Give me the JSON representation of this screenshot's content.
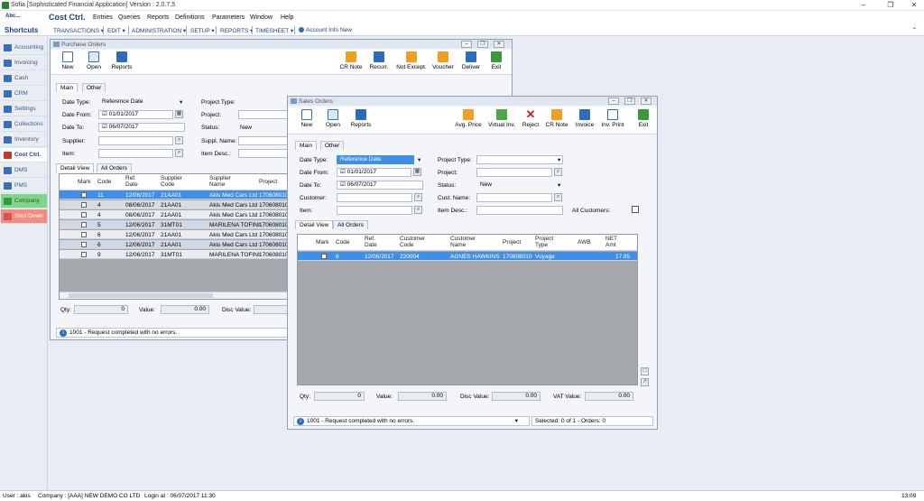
{
  "window_title": "Sofia [Sophisticated Financial Application] Version : 2.0.7.5",
  "menubar": {
    "logo": "Abc...",
    "module": "Cost Ctrl.",
    "items": [
      "Entries",
      "Queries",
      "Reports",
      "Definitions",
      "Parameters",
      "Window",
      "Help"
    ]
  },
  "shortcuts": {
    "title": "Shortcuts",
    "items": [
      "TRANSACTIONS ▾",
      "EDIT ▾",
      "ADMINISTRATION ▾",
      "SETUP ▾",
      "REPORTS ▾",
      "TIMESHEET ▾",
      "Account Info New"
    ]
  },
  "sidebar": [
    {
      "label": "Accounting",
      "color": "#3b6fb5"
    },
    {
      "label": "Invoicing",
      "color": "#3b6fb5"
    },
    {
      "label": "Cash",
      "color": "#3b6fb5"
    },
    {
      "label": "CRM",
      "color": "#3b6fb5"
    },
    {
      "label": "Settings",
      "color": "#3b6fb5"
    },
    {
      "label": "Collections",
      "color": "#3b6fb5"
    },
    {
      "label": "Inventory",
      "color": "#3b6fb5"
    },
    {
      "label": "Cost Ctrl.",
      "color": "#c0392b"
    },
    {
      "label": "DMS",
      "color": "#3b6fb5"
    },
    {
      "label": "PMS",
      "color": "#3b6fb5"
    },
    {
      "label": "Company",
      "color": "#2e9b3e"
    },
    {
      "label": "Shut Down",
      "color": "#d9534f"
    }
  ],
  "purchase": {
    "title": "Purchase Orders",
    "toolbar_left": [
      "New",
      "Open",
      "Reports"
    ],
    "toolbar_right": [
      "CR Note",
      "Recurr.",
      "Not Except.",
      "Voucher",
      "Deliver",
      "Exit"
    ],
    "tabs": [
      "Main",
      "Other"
    ],
    "labels": {
      "date_type": "Date Type:",
      "date_from": "Date From:",
      "date_to": "Date To:",
      "supplier": "Supplier:",
      "item": "Item:",
      "project_type": "Project Type:",
      "project": "Project:",
      "status": "Status:",
      "suppl_name": "Suppl. Name:",
      "item_desc": "Item Desc.:"
    },
    "values": {
      "date_type": "Reference Date",
      "date_from": "01/01/2017",
      "date_to": "06/07/2017",
      "status": "New"
    },
    "grid_tabs": [
      "Detail View",
      "All Orders"
    ],
    "columns": [
      "Mark",
      "Code",
      "Ref.\nDate",
      "Supplier\nCode",
      "Supplier\nName",
      "Project"
    ],
    "rows": [
      [
        "11",
        "12/06/2017",
        "21AA01",
        "Akis Med Cars Ltd",
        "170608010"
      ],
      [
        "4",
        "08/06/2017",
        "21AA01",
        "Akis Med Cars Ltd",
        "170608010"
      ],
      [
        "4",
        "08/06/2017",
        "21AA01",
        "Akis Med Cars Ltd",
        "170608010"
      ],
      [
        "5",
        "12/06/2017",
        "31MT01",
        "MARILENA TOFINI",
        "170608010"
      ],
      [
        "6",
        "12/06/2017",
        "21AA01",
        "Akis Med Cars Ltd",
        "170608010"
      ],
      [
        "6",
        "12/06/2017",
        "21AA01",
        "Akis Med Cars Ltd",
        "170608010"
      ],
      [
        "9",
        "12/06/2017",
        "31MT01",
        "MARILENA TOFINI",
        "170608010"
      ]
    ],
    "totals": {
      "qty_label": "Qty:",
      "qty": "0",
      "value_label": "Value:",
      "value": "0.00",
      "disc_label": "Disc Value:"
    },
    "status": "1001 -  Request completed with no errors."
  },
  "sales": {
    "title": "Sales Orders",
    "toolbar_left": [
      "New",
      "Open",
      "Reports"
    ],
    "toolbar_right": [
      "Avg. Price",
      "Virtual Inv.",
      "Reject",
      "CR Note",
      "Invoice",
      "Inv. Print",
      "Exit"
    ],
    "tabs": [
      "Main",
      "Other"
    ],
    "labels": {
      "date_type": "Date Type:",
      "date_from": "Date From:",
      "date_to": "Date To:",
      "customer": "Customer:",
      "item": "Item:",
      "project_type": "Project Type:",
      "project": "Project:",
      "status": "Status:",
      "cust_name": "Cust. Name:",
      "item_desc": "Item Desc.:",
      "all_customers": "All Customers:"
    },
    "values": {
      "date_type": "Reference Date",
      "date_from": "01/01/2017",
      "date_to": "06/07/2017",
      "status": "New"
    },
    "grid_tabs": [
      "Detail View",
      "All Orders"
    ],
    "columns": [
      "Mark",
      "Code",
      "Ref.\nDate",
      "Customer\nCode",
      "Customer\nName",
      "Project",
      "Project\nType",
      "AWB",
      "NET\nAmt"
    ],
    "rows": [
      [
        "6",
        "12/06/2017",
        "220004",
        "AGNES HAWKINS",
        "170608010",
        "Voyage",
        "",
        "17.85"
      ]
    ],
    "totals": {
      "qty_label": "Qty:",
      "qty": "0",
      "value_label": "Value:",
      "value": "0.00",
      "disc_label": "Disc Value:",
      "disc": "0.00",
      "vat_label": "VAT Value:",
      "vat": "0.00"
    },
    "status": "1001 -  Request completed with no errors.",
    "selected": "Selected: 0 of 1 - Orders: 0"
  },
  "statusbar": {
    "user": "User : akis",
    "company": "Company : [AAA] NEW DEMO CO LTD",
    "login": "Login at : 06/07/2017 11:30",
    "clock": "13:09"
  }
}
